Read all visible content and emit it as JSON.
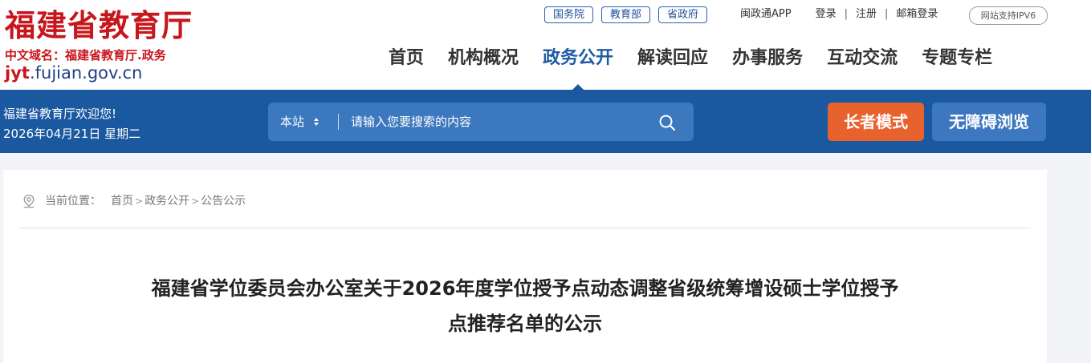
{
  "site": {
    "title": "福建省教育厅",
    "domain_label": "中文域名：福建省教育厅.政务",
    "url_prefix": "jyt",
    "url_rest": ".fujian.gov.cn"
  },
  "gov_links": [
    "国务院",
    "教育部",
    "省政府"
  ],
  "top_links": {
    "app": "闽政通APP",
    "login": "登录",
    "register": "注册",
    "mail_login": "邮箱登录",
    "ipv6": "网站支持IPV6"
  },
  "nav": {
    "items": [
      "首页",
      "机构概况",
      "政务公开",
      "解读回应",
      "办事服务",
      "互动交流",
      "专题专栏"
    ],
    "active": "政务公开"
  },
  "banner": {
    "welcome": "福建省教育厅欢迎您!",
    "date": "2026年04月21日 星期二",
    "search_scope": "本站",
    "search_placeholder": "请输入您要搜索的内容",
    "elder_mode": "长者模式",
    "accessible_browse": "无障碍浏览"
  },
  "breadcrumb": {
    "label": "当前位置：",
    "items": [
      "首页",
      "政务公开",
      "公告公示"
    ]
  },
  "article": {
    "title_line1": "福建省学位委员会办公室关于2026年度学位授予点动态调整省级统筹增设硕士学位授予",
    "title_line2": "点推荐名单的公示"
  },
  "colors": {
    "brand_red": "#c8161d",
    "banner_blue": "#1a589f",
    "accent_orange": "#e8622e"
  }
}
